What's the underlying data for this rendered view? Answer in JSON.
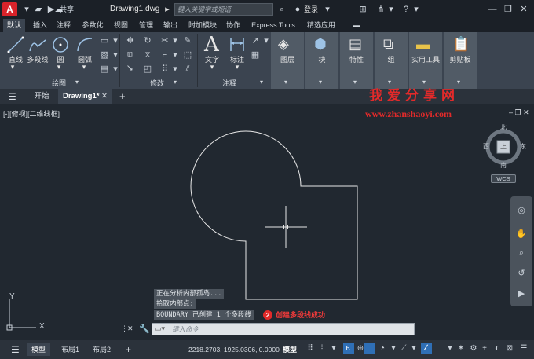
{
  "titlebar": {
    "logo_letter": "A",
    "share_label": "共享",
    "doc_title": "Drawing1.dwg",
    "search_placeholder": "键入关键字或短语",
    "login_label": "登录"
  },
  "ribbon_tabs": [
    "默认",
    "插入",
    "注释",
    "参数化",
    "视图",
    "管理",
    "输出",
    "附加模块",
    "协作",
    "Express Tools",
    "精选应用"
  ],
  "ribbon": {
    "draw": {
      "line": "直线",
      "polyline": "多段线",
      "circle": "圆",
      "arc": "圆弧",
      "panel_label": "绘图"
    },
    "modify": {
      "panel_label": "修改"
    },
    "annotation": {
      "text": "文字",
      "dimension": "标注",
      "panel_label": "注释"
    },
    "big_buttons": [
      "图层",
      "块",
      "特性",
      "组",
      "实用工具",
      "剪贴板"
    ]
  },
  "filetabs": {
    "start": "开始",
    "drawing": "Drawing1*"
  },
  "view_label": "[-][俯视][二维线框]",
  "watermark": {
    "line1": "我爱分享网",
    "line2": "www.zhanshaoyi.com"
  },
  "viewcube": {
    "north": "北",
    "south": "南",
    "east": "东",
    "west": "西",
    "face": "上",
    "wcs": "WCS"
  },
  "command_history": [
    "正在分析内部孤岛...",
    "拾取内部点:",
    "BOUNDARY 已创建 1 个多段线"
  ],
  "step": {
    "number": "2",
    "text": "创建多段线成功"
  },
  "command_placeholder": "键入命令",
  "status": {
    "layout_tabs": [
      "模型",
      "布局1",
      "布局2"
    ],
    "coords": "2218.2703, 1925.0306, 0.0000",
    "model_label": "模型"
  },
  "ucs": {
    "x_label": "X",
    "y_label": "Y"
  }
}
